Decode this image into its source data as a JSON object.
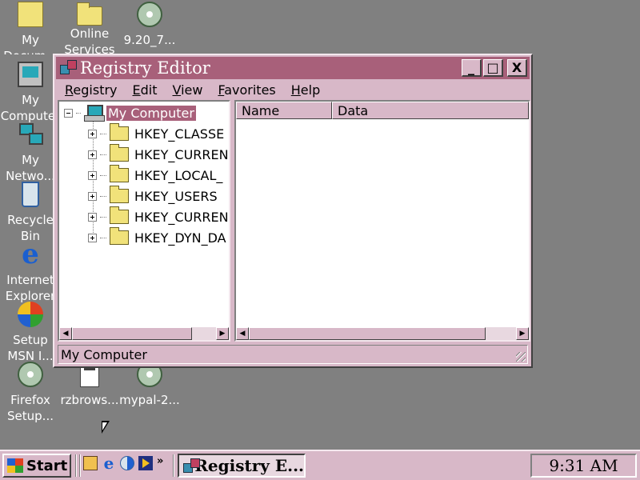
{
  "desktop": {
    "icons": [
      {
        "label": "My\nDocum...",
        "icon": "my-documents-icon"
      },
      {
        "label": "Online\nServices",
        "icon": "folder-icon"
      },
      {
        "label": "9.20_7...",
        "icon": "setup-package-icon"
      },
      {
        "label": "My\nComputer",
        "icon": "my-computer-icon"
      },
      {
        "label": "My\nNetwo...",
        "icon": "network-icon"
      },
      {
        "label": "Recycle\nBin",
        "icon": "recycle-bin-icon"
      },
      {
        "label": "Internet\nExplorer",
        "icon": "internet-explorer-icon"
      },
      {
        "label": "Setup\nMSN I...",
        "icon": "msn-butterfly-icon"
      },
      {
        "label": "Firefox\nSetup...",
        "icon": "setup-disc-icon"
      },
      {
        "label": "rzbrows...",
        "icon": "application-icon"
      },
      {
        "label": "mypal-2...",
        "icon": "setup-disc-icon"
      }
    ]
  },
  "window": {
    "title": "Registry Editor",
    "buttons": {
      "minimize": "_",
      "maximize": "□",
      "close": "X"
    },
    "menu": [
      {
        "label": "Registry",
        "accel": "R",
        "rest": "egistry"
      },
      {
        "label": "Edit",
        "accel": "E",
        "rest": "dit"
      },
      {
        "label": "View",
        "accel": "V",
        "rest": "iew"
      },
      {
        "label": "Favorites",
        "accel": "F",
        "rest": "avorites"
      },
      {
        "label": "Help",
        "accel": "H",
        "rest": "elp"
      }
    ],
    "tree": {
      "root": "My Computer",
      "keys": [
        "HKEY_CLASSE",
        "HKEY_CURREN",
        "HKEY_LOCAL_",
        "HKEY_USERS",
        "HKEY_CURREN",
        "HKEY_DYN_DA"
      ]
    },
    "list": {
      "columns": [
        "Name",
        "Data"
      ]
    },
    "status": "My Computer"
  },
  "taskbar": {
    "start": "Start",
    "task": "Registry E...",
    "quicklaunch_more": "»",
    "clock": "9:31 AM"
  },
  "colors": {
    "desktop": "#808080",
    "chrome": "#d8b8c8",
    "title_active": "#a8607a"
  }
}
